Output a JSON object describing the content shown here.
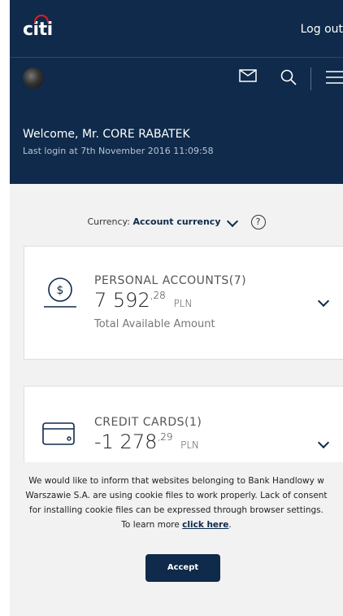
{
  "header": {
    "logo_text": "citi",
    "logout_label": "Log out"
  },
  "subheader": {
    "welcome": "Welcome, Mr. CORE RABATEK",
    "last_login": "Last login at 7th November 2016 11:09:58",
    "icons": [
      "avatar",
      "mail-icon",
      "search-icon",
      "menu-icon"
    ]
  },
  "currency": {
    "label": "Currency:",
    "value": "Account currency",
    "help": "?"
  },
  "cards": [
    {
      "title": "PERSONAL ACCOUNTS(7)",
      "amount_int": "7 592",
      "amount_dec": ",28",
      "currency": "PLN",
      "subtitle": "Total Available Amount",
      "icon": "dollar-coin-icon"
    },
    {
      "title": "CREDIT CARDS(1)",
      "amount_int": "-1 278",
      "amount_dec": ",29",
      "currency": "PLN",
      "subtitle": "",
      "icon": "credit-card-icon"
    }
  ],
  "cookie": {
    "text": "We would like to inform that websites belonging to Bank Handlowy w Warszawie S.A. are using cookie files to work properly. Lack of consent for installing cookie files can be expressed through browser settings. To learn more ",
    "link": "click here",
    "end": ".",
    "accept_label": "Accept"
  },
  "colors": {
    "navy": "#0f2a4a",
    "background": "#f2f2f2",
    "logo_arc": "#dd2222"
  }
}
